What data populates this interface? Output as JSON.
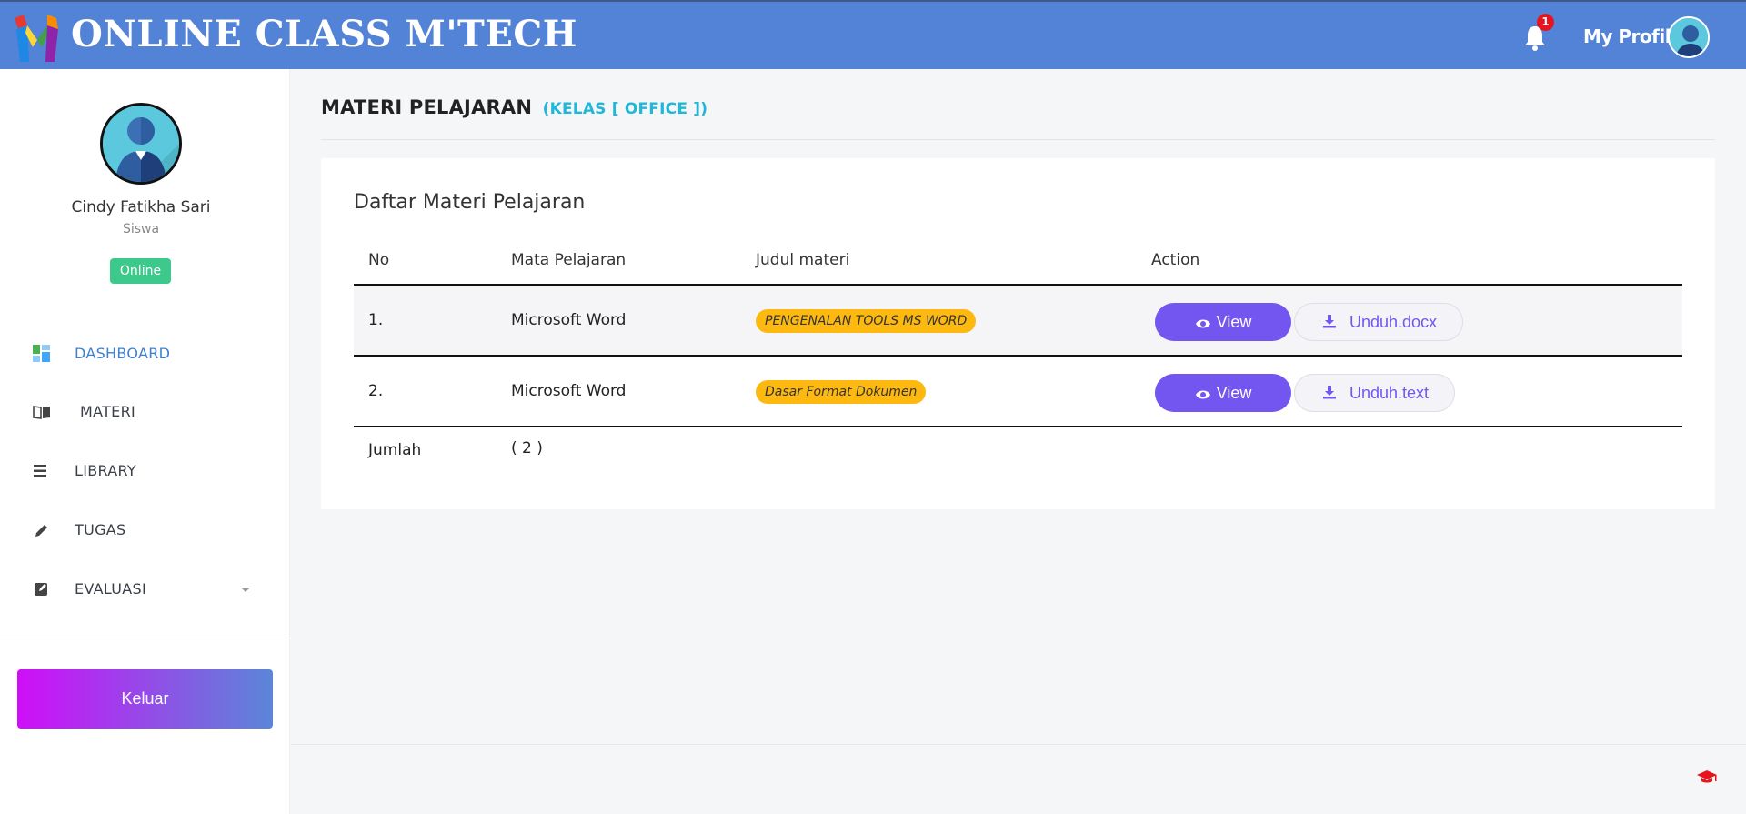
{
  "header": {
    "app_title": "ONLINE CLASS M'TECH",
    "notification_count": "1",
    "profile_label": "My Profile",
    "brand_color": "#5383d6"
  },
  "sidebar": {
    "user_name": "Cindy Fatikha Sari",
    "user_role": "Siswa",
    "status": "Online",
    "items": [
      {
        "label": "DASHBOARD",
        "icon": "dashboard-icon",
        "active": true
      },
      {
        "label": "MATERI",
        "icon": "book-icon",
        "active": false
      },
      {
        "label": "LIBRARY",
        "icon": "list-icon",
        "active": false
      },
      {
        "label": "TUGAS",
        "icon": "pencil-icon",
        "active": false
      },
      {
        "label": "EVALUASI",
        "icon": "edit-icon",
        "active": false
      }
    ],
    "logout_label": "Keluar"
  },
  "main": {
    "page_title": "MATERI PELAJARAN",
    "page_subtitle": "(KELAS [ OFFICE ])",
    "card_title": "Daftar Materi Pelajaran",
    "table": {
      "columns": [
        "No",
        "Mata Pelajaran",
        "Judul materi",
        "Action"
      ],
      "rows": [
        {
          "no": "1.",
          "subject": "Microsoft Word",
          "title": "PENGENALAN TOOLS MS WORD",
          "view_label": "View",
          "download_label": "Unduh.docx"
        },
        {
          "no": "2.",
          "subject": "Microsoft Word",
          "title": "Dasar Format Dokumen",
          "view_label": "View",
          "download_label": "Unduh.text"
        }
      ],
      "total_label": "Jumlah",
      "total_value": "( 2 )"
    }
  },
  "colors": {
    "accent_purple": "#7355f0",
    "badge_yellow": "#fdb90f",
    "status_green": "#3ec98c",
    "subtitle_cyan": "#20b7d8"
  }
}
